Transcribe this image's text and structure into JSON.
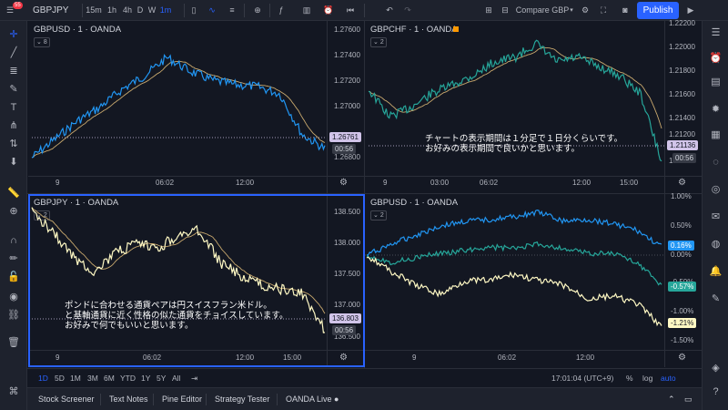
{
  "toolbar": {
    "symbol": "GBPJPY",
    "intervals": [
      "15m",
      "1h",
      "4h",
      "D",
      "W",
      "1m"
    ],
    "compare": "Compare GBP",
    "publish": "Publish",
    "notif_count": "55"
  },
  "panes": [
    {
      "id": "tl",
      "title": "GBPUSD · 1 · OANDA",
      "collapse": "8",
      "price_ticks": [
        "1.27600",
        "1.27400",
        "1.27200",
        "1.27000",
        "1.26800"
      ],
      "time_ticks": [
        "9",
        "06:02",
        "12:00"
      ],
      "last_price": "1.26761",
      "countdown": "00:56",
      "color": "#2196f3"
    },
    {
      "id": "tr",
      "title": "GBPCHF · 1 · OANDA",
      "collapse": "2",
      "price_ticks": [
        "1.22200",
        "1.22000",
        "1.21800",
        "1.21600",
        "1.21400",
        "1.21200",
        "1.2"
      ],
      "time_ticks": [
        "9",
        "03:00",
        "06:02",
        "12:00",
        "15:00"
      ],
      "last_price": "1.21136",
      "countdown": "00:56",
      "color": "#26a69a",
      "note": [
        "チャートの表示期間は１分足で１日分くらいです。",
        "お好みの表示期間で良いかと思います。"
      ]
    },
    {
      "id": "bl",
      "title": "GBPJPY · 1 · OANDA",
      "collapse": "2",
      "price_ticks": [
        "138.500",
        "138.000",
        "137.500",
        "137.000",
        "136.500"
      ],
      "time_ticks": [
        "9",
        "06:02",
        "12:00",
        "15:00"
      ],
      "last_price": "136.803",
      "countdown": "00:56",
      "color": "#fff9c4",
      "note": [
        "ポンドに合わせる通貨ペアは円スイスフラン米ドル。",
        "と基軸通貨に近く性格の似た通貨をチョイスしています。",
        "お好みで何でもいいと思います。"
      ]
    },
    {
      "id": "br",
      "title": "GBPUSD · 1 · OANDA",
      "collapse": "2",
      "price_ticks": [
        "1.00%",
        "0.50%",
        "0.00%",
        "-0.50%",
        "-1.00%",
        "-1.50%"
      ],
      "time_ticks": [
        "9",
        "06:02",
        "12:00"
      ],
      "labels": [
        {
          "text": "0.16%",
          "color": "#2196f3"
        },
        {
          "text": "-0.57%",
          "color": "#26a69a"
        },
        {
          "text": "-1.21%",
          "color": "#fff9c4"
        }
      ]
    }
  ],
  "range_bar": {
    "ranges": [
      "1D",
      "5D",
      "1M",
      "3M",
      "6M",
      "YTD",
      "1Y",
      "5Y",
      "All"
    ],
    "time": "17:01:04 (UTC+9)",
    "pct": "%",
    "log": "log",
    "auto": "auto"
  },
  "bottom_tabs": [
    "Stock Screener",
    "Text Notes",
    "Pine Editor",
    "Strategy Tester",
    "OANDA Live"
  ],
  "colors": {
    "accent": "#2962ff",
    "usd": "#2196f3",
    "chf": "#26a69a",
    "jpy": "#fff9c4",
    "ma": "#c9a96e"
  }
}
